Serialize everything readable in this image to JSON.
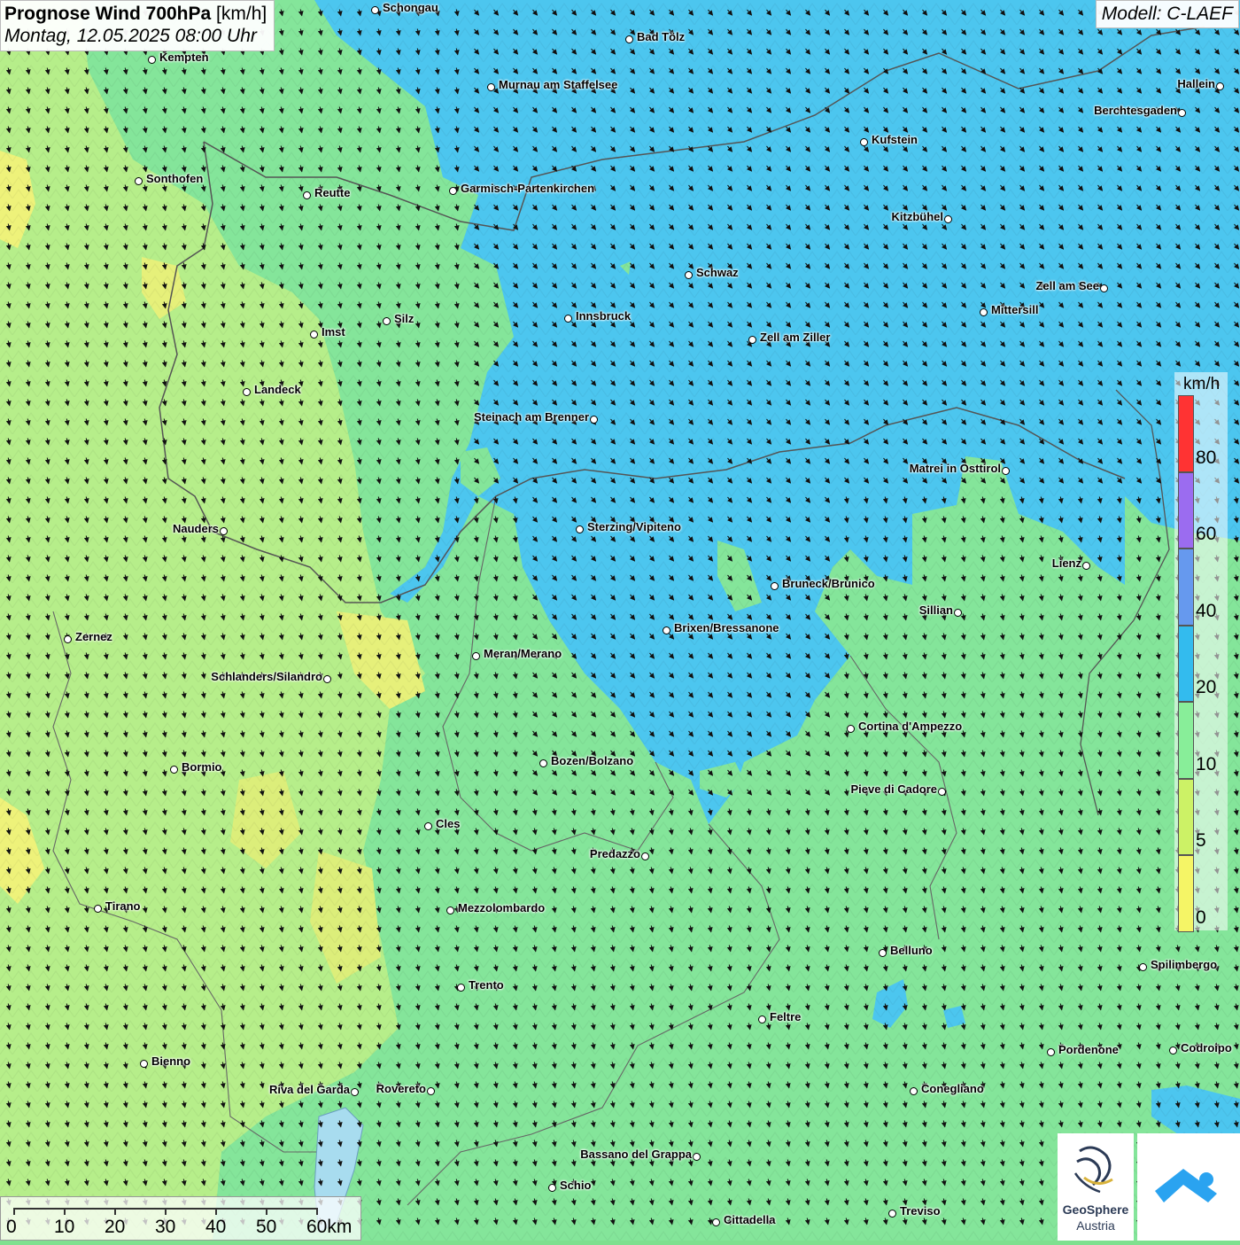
{
  "title": {
    "product": "Prognose Wind 700hPa",
    "unit": "[km/h]",
    "datetime": "Montag, 12.05.2025 08:00 Uhr"
  },
  "model_label": "Modell: C-LAEF",
  "legend": {
    "unit": "km/h",
    "ticks": [
      "80",
      "60",
      "40",
      "20",
      "10",
      "5",
      "0"
    ],
    "colors": [
      "#ff3333",
      "#9b6cf0",
      "#6699ee",
      "#33bbee",
      "#88ee99",
      "#ccf266",
      "#f5f566"
    ]
  },
  "scale_bar": {
    "labels": [
      "0",
      "10",
      "20",
      "30",
      "40",
      "50",
      "60km"
    ]
  },
  "logos": {
    "geosphere_line1": "GeoSphere",
    "geosphere_line2": "Austria"
  },
  "cities": [
    {
      "name": "Schongau",
      "label_side": "right"
    },
    {
      "name": "Bad Tölz",
      "label_side": "right"
    },
    {
      "name": "Kempten",
      "label_side": "right"
    },
    {
      "name": "Murnau am Staffelsee",
      "label_side": "right"
    },
    {
      "name": "Hallein",
      "label_side": "left"
    },
    {
      "name": "Berchtesgaden",
      "label_side": "left"
    },
    {
      "name": "Kufstein",
      "label_side": "right"
    },
    {
      "name": "Sonthofen",
      "label_side": "right"
    },
    {
      "name": "Reutte",
      "label_side": "right"
    },
    {
      "name": "Garmisch-Partenkirchen",
      "label_side": "right"
    },
    {
      "name": "Kitzbühel",
      "label_side": "left"
    },
    {
      "name": "Schwaz",
      "label_side": "right"
    },
    {
      "name": "Zell am See",
      "label_side": "left"
    },
    {
      "name": "Innsbruck",
      "label_side": "right"
    },
    {
      "name": "Mittersill",
      "label_side": "right"
    },
    {
      "name": "Zell am Ziller",
      "label_side": "right"
    },
    {
      "name": "Silz",
      "label_side": "right"
    },
    {
      "name": "Imst",
      "label_side": "right"
    },
    {
      "name": "Landeck",
      "label_side": "right"
    },
    {
      "name": "Steinach am Brenner",
      "label_side": "left"
    },
    {
      "name": "Matrei in Osttirol",
      "label_side": "left"
    },
    {
      "name": "Nauders",
      "label_side": "left"
    },
    {
      "name": "Sterzing/Vipiteno",
      "label_side": "right"
    },
    {
      "name": "Lienz",
      "label_side": "left"
    },
    {
      "name": "Bruneck/Brunico",
      "label_side": "right"
    },
    {
      "name": "Sillian",
      "label_side": "left"
    },
    {
      "name": "Zernez",
      "label_side": "right"
    },
    {
      "name": "Brixen/Bressanone",
      "label_side": "right"
    },
    {
      "name": "Meran/Merano",
      "label_side": "right"
    },
    {
      "name": "Schlanders/Silandro",
      "label_side": "left"
    },
    {
      "name": "Cortina d'Ampezzo",
      "label_side": "right"
    },
    {
      "name": "Bozen/Bolzano",
      "label_side": "right"
    },
    {
      "name": "Bormio",
      "label_side": "right"
    },
    {
      "name": "Pieve di Cadore",
      "label_side": "left"
    },
    {
      "name": "Cles",
      "label_side": "right"
    },
    {
      "name": "Predazzo",
      "label_side": "left"
    },
    {
      "name": "Tirano",
      "label_side": "right"
    },
    {
      "name": "Mezzolombardo",
      "label_side": "right"
    },
    {
      "name": "Belluno",
      "label_side": "right"
    },
    {
      "name": "Spilimbergo",
      "label_side": "right"
    },
    {
      "name": "Trento",
      "label_side": "right"
    },
    {
      "name": "Feltre",
      "label_side": "right"
    },
    {
      "name": "Pordenone",
      "label_side": "right"
    },
    {
      "name": "Codroipo",
      "label_side": "right"
    },
    {
      "name": "Bienno",
      "label_side": "right"
    },
    {
      "name": "Riva del Garda",
      "label_side": "left"
    },
    {
      "name": "Rovereto",
      "label_side": "left"
    },
    {
      "name": "Conegliano",
      "label_side": "right"
    },
    {
      "name": "Bassano del Grappa",
      "label_side": "left"
    },
    {
      "name": "Schio",
      "label_side": "right"
    },
    {
      "name": "Treviso",
      "label_side": "right"
    },
    {
      "name": "Cittadella",
      "label_side": "right"
    }
  ]
}
